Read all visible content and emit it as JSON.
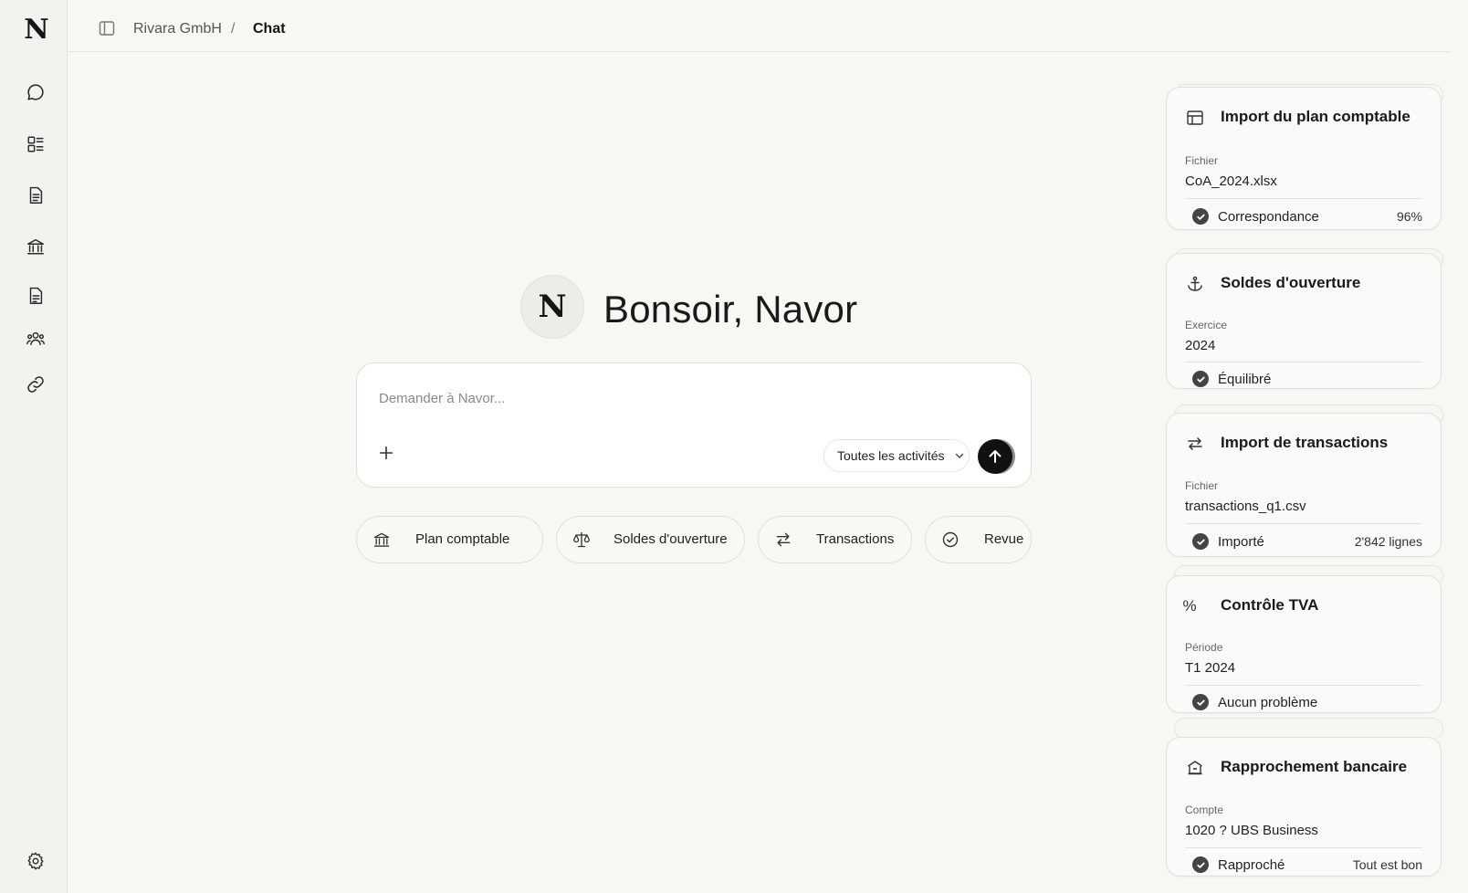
{
  "app": {
    "logo_letter": "N"
  },
  "sidebar": {
    "items": [
      {
        "icon": "chat-bubble-icon"
      },
      {
        "icon": "dashboard-icon"
      },
      {
        "icon": "document-icon"
      },
      {
        "icon": "bank-icon"
      },
      {
        "icon": "report-icon"
      },
      {
        "icon": "users-icon"
      },
      {
        "icon": "link-icon"
      }
    ],
    "settings_icon": "gear-icon"
  },
  "header": {
    "organization": "Rivara GmbH",
    "separator": "/",
    "current": "Chat"
  },
  "greeting": {
    "avatar_letter": "N",
    "text": "Bonsoir, Navor"
  },
  "composer": {
    "placeholder": "Demander à Navor...",
    "value": "",
    "activity_filter": "Toutes les activités"
  },
  "quick_actions": [
    {
      "label": "Plan comptable",
      "icon": "bank-icon"
    },
    {
      "label": "Soldes d'ouverture",
      "icon": "scale-icon"
    },
    {
      "label": "Transactions",
      "icon": "swap-arrows-icon"
    },
    {
      "label": "Revue",
      "icon": "check-circle-icon"
    }
  ],
  "cards": [
    {
      "icon": "table-icon",
      "title": "Import du plan comptable",
      "field_label": "Fichier",
      "field_value": "CoA_2024.xlsx",
      "status": "Correspondance",
      "meta": "96%"
    },
    {
      "icon": "anchor-icon",
      "title": "Soldes d'ouverture",
      "field_label": "Exercice",
      "field_value": "2024",
      "status": "Équilibré",
      "meta": ""
    },
    {
      "icon": "swap-arrows-icon",
      "title": "Import de transactions",
      "field_label": "Fichier",
      "field_value": "transactions_q1.csv",
      "status": "Importé",
      "meta": "2'842 lignes"
    },
    {
      "icon": "percent-icon",
      "icon_glyph": "%",
      "title": "Contrôle TVA",
      "field_label": "Période",
      "field_value": "T1 2024",
      "status": "Aucun problème",
      "meta": ""
    },
    {
      "icon": "bank-building-icon",
      "title": "Rapprochement bancaire",
      "field_label": "Compte",
      "field_value": "1020 ? UBS Business",
      "status": "Rapproché",
      "meta": "Tout est bon"
    }
  ]
}
